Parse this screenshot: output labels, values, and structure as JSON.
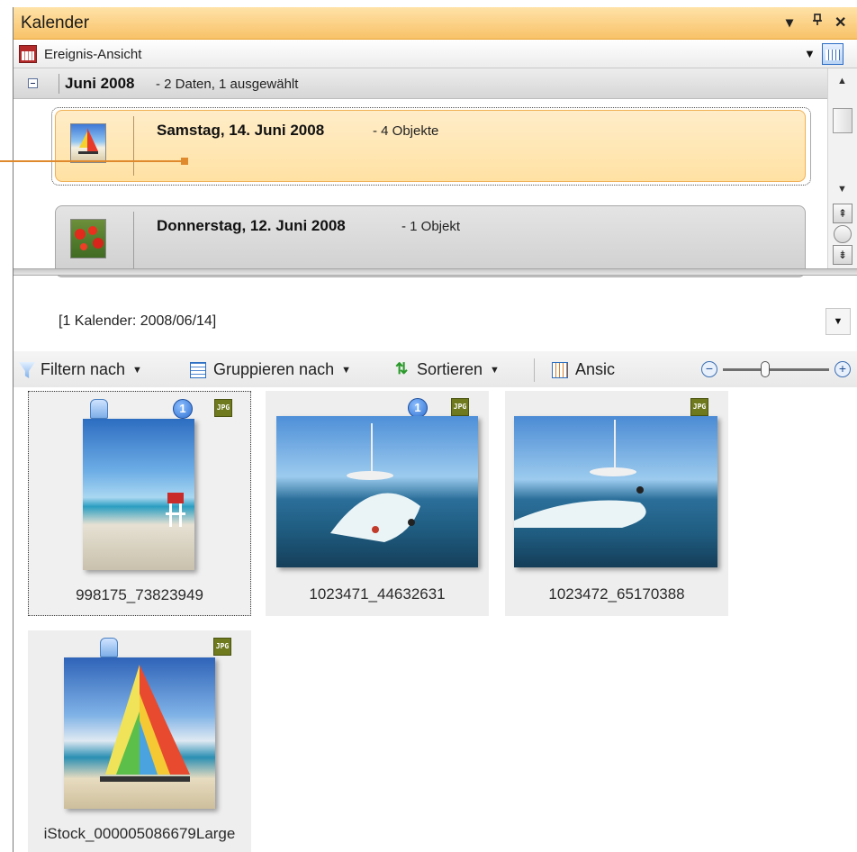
{
  "window": {
    "title": "Kalender",
    "controls": {
      "menu": "▾",
      "pin": "ᵖ",
      "close": "✕"
    }
  },
  "view_selector": {
    "label": "Ereignis-Ansicht"
  },
  "month_group": {
    "month": "Juni 2008",
    "meta": "- 2 Daten, 1 ausgewählt"
  },
  "events": [
    {
      "date": "Samstag, 14. Juni 2008",
      "count": "- 4 Objekte",
      "selected": true
    },
    {
      "date": "Donnerstag, 12. Juni 2008",
      "count": "- 1 Objekt",
      "selected": false
    }
  ],
  "path_bar": {
    "text": "[1 Kalender: 2008/06/14]"
  },
  "toolbar": {
    "filter_label": "Filtern nach",
    "group_label": "Gruppieren nach",
    "sort_label": "Sortieren",
    "view_label": "Ansic"
  },
  "thumbnails": [
    {
      "name": "998175_73823949",
      "type_badge": "JPG",
      "count_badge": "1"
    },
    {
      "name": "1023471_44632631",
      "type_badge": "JPG",
      "count_badge": "1"
    },
    {
      "name": "1023472_65170388",
      "type_badge": "JPG"
    },
    {
      "name": "iStock_000005086679Large",
      "type_badge": "JPG"
    }
  ],
  "colors": {
    "title_bar": "#f8c268",
    "selected_event": "#ffe1a3",
    "accent_blue": "#2e6fd0",
    "callout": "#e08a2e"
  }
}
